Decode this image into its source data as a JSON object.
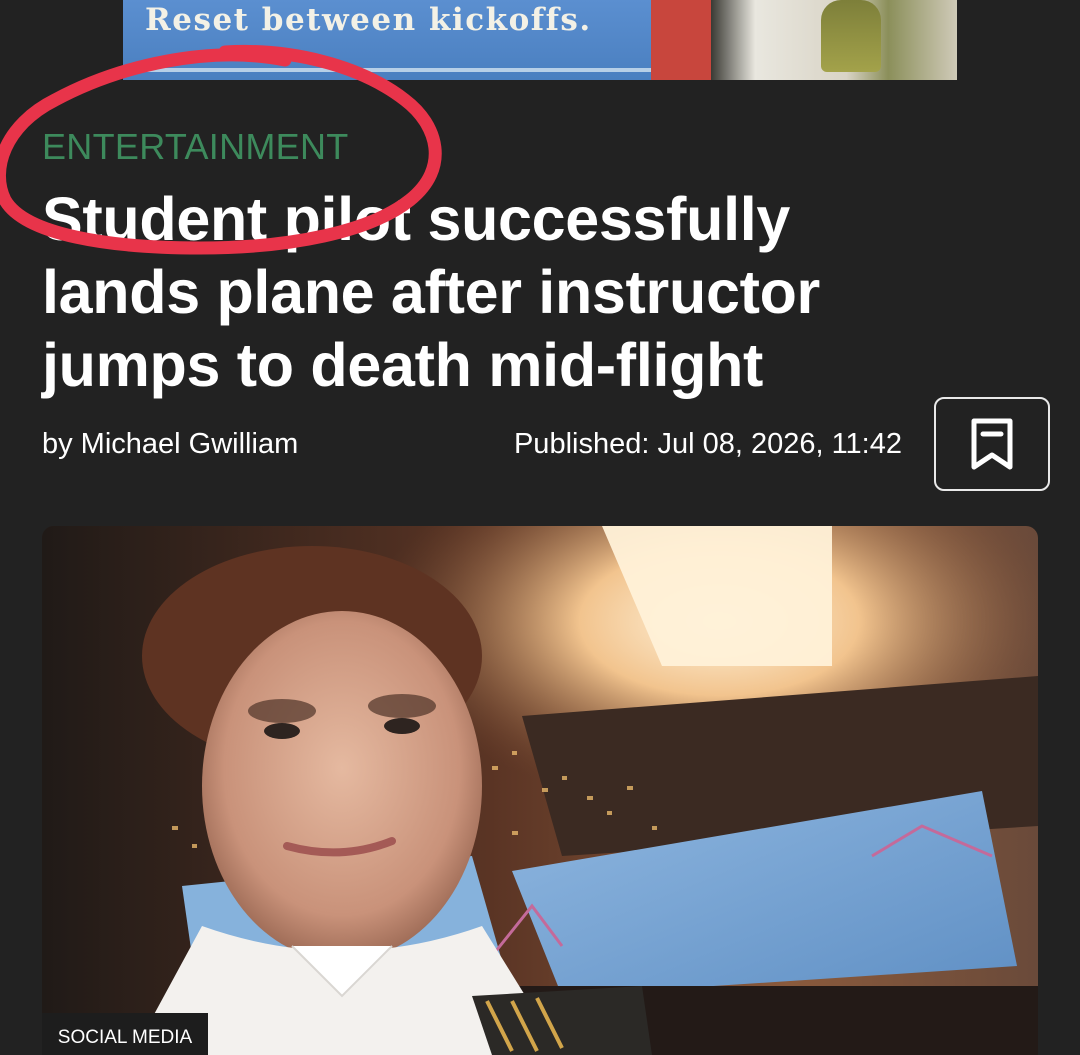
{
  "ad": {
    "text": "Reset between kickoffs."
  },
  "article": {
    "category": "ENTERTAINMENT",
    "headline": "Student pilot successfully lands plane after instructor jumps to death mid-flight",
    "byline": "by Michael Gwilliam",
    "published": "Published: Jul 08, 2026, 11:42"
  },
  "hero_image": {
    "credit": "SOCIAL MEDIA"
  },
  "icons": {
    "bookmark": "bookmark-icon"
  },
  "colors": {
    "background": "#222222",
    "category": "#3d8a5c",
    "text": "#ffffff",
    "annotation": "#e8344a"
  }
}
